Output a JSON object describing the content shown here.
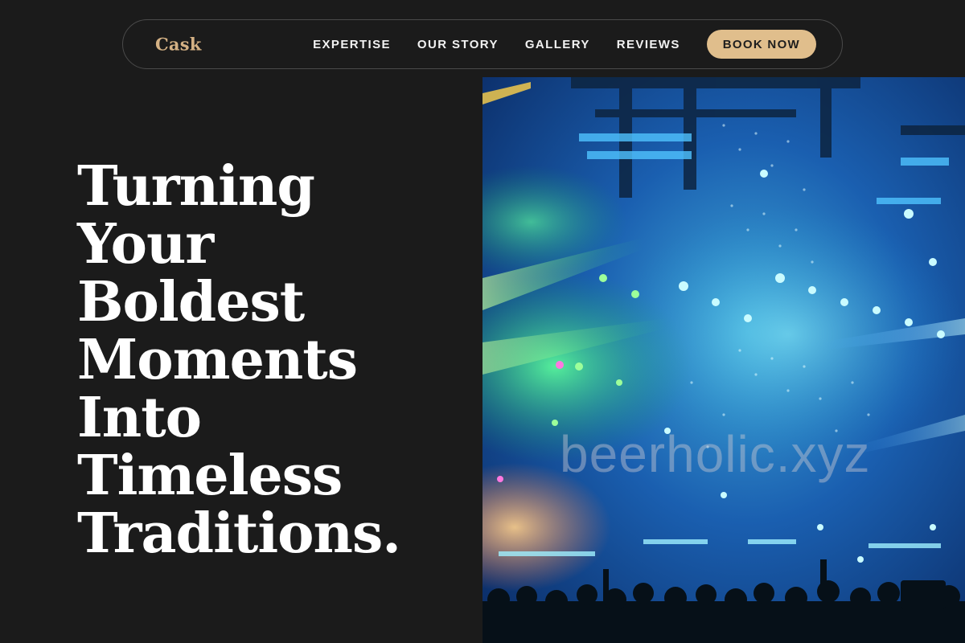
{
  "brand": {
    "logo": "Cask"
  },
  "nav": {
    "links": [
      "EXPERTISE",
      "OUR STORY",
      "GALLERY",
      "REVIEWS"
    ],
    "cta": "BOOK NOW"
  },
  "hero": {
    "title_lines": [
      "Turning",
      "Your",
      "Boldest",
      "Moments",
      "Into",
      "Timeless",
      "Traditions."
    ],
    "image_watermark": "beerholic.xyz"
  },
  "colors": {
    "background": "#1b1b1b",
    "accent": "#e0be8c",
    "logo": "#d4b184",
    "text": "#ffffff"
  }
}
